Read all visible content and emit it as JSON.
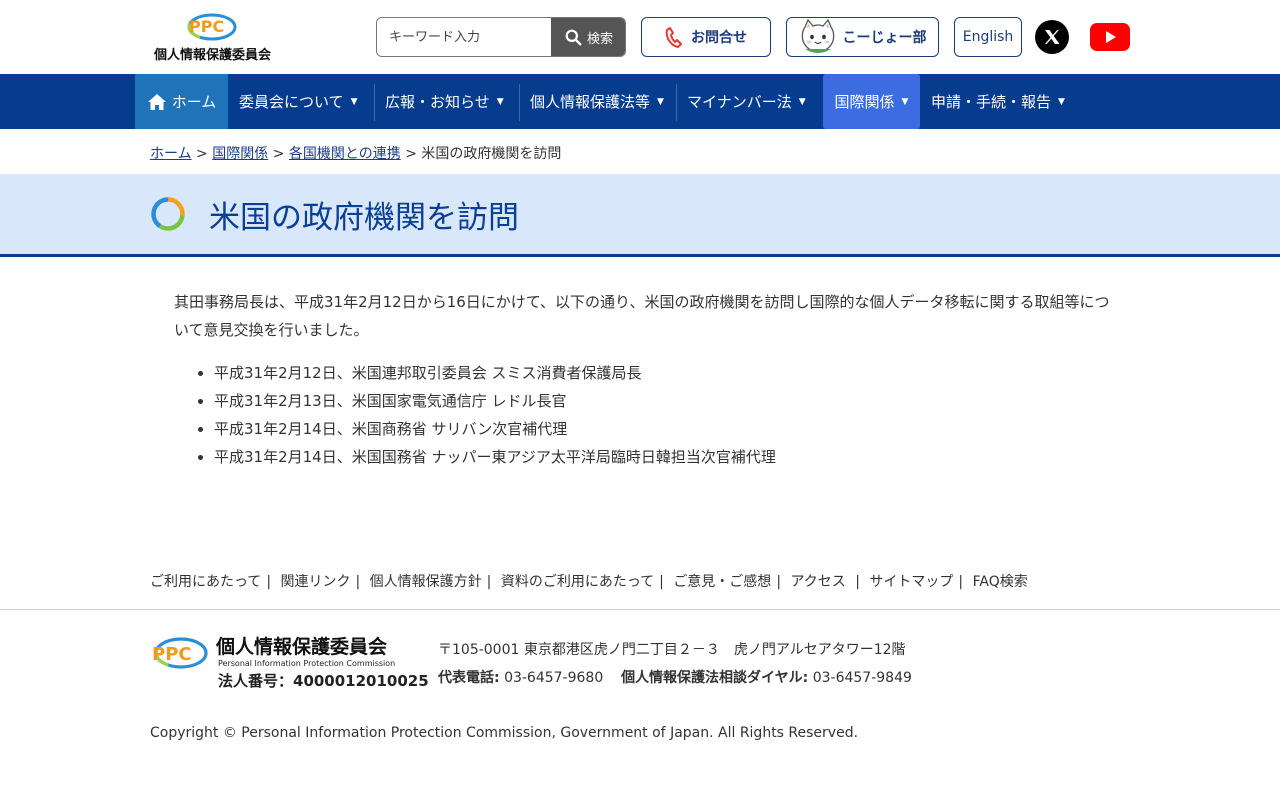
{
  "header": {
    "logo_text": "個人情報保護委員会",
    "logo_mark": "PPC",
    "search": {
      "placeholder": "キーワード入力",
      "button_label": "検索"
    },
    "contact_label": "お問合せ",
    "koujo_label": "こーじょー部",
    "english_label": "English",
    "icons": [
      "search-icon",
      "phone-icon",
      "cat-mascot-icon",
      "x-icon",
      "youtube-icon"
    ]
  },
  "nav": {
    "home": "ホーム",
    "items": [
      "委員会について",
      "広報・お知らせ",
      "個人情報保護法等",
      "マイナンバー法",
      "国際関係",
      "申請・手続・報告"
    ],
    "caret": "▼",
    "active": "国際関係"
  },
  "breadcrumb": {
    "items": [
      "ホーム",
      "国際関係",
      "各国機関との連携"
    ],
    "current": "米国の政府機関を訪問",
    "separator": ">"
  },
  "page": {
    "title": "米国の政府機関を訪問",
    "intro": "其田事務局長は、平成31年2月12日から16日にかけて、以下の通り、米国の政府機関を訪問し国際的な個人データ移転に関する取組等について意見交換を行いました。",
    "visits": [
      "平成31年2月12日、米国連邦取引委員会 スミス消費者保護局長",
      "平成31年2月13日、米国国家電気通信庁 レドル長官",
      "平成31年2月14日、米国商務省 サリバン次官補代理",
      "平成31年2月14日、米国国務省 ナッパー東アジア太平洋局臨時日韓担当次官補代理"
    ]
  },
  "footer": {
    "links": [
      "ご利用にあたって",
      "関連リンク",
      "個人情報保護方針",
      "資料のご利用にあたって",
      "ご意見・ご感想",
      "アクセス",
      "サイトマップ",
      "FAQ検索"
    ],
    "org_name": "個人情報保護委員会",
    "org_name_en": "Personal Information Protection Commission",
    "corp_number": "法人番号：4000012010025",
    "address": "〒105-0001 東京都港区虎ノ門二丁目２－３　虎ノ門アルセアタワー12階",
    "main_phone_label": "代表電話:",
    "main_phone": "03-6457-9680",
    "consult_label": "個人情報保護法相談ダイヤル:",
    "consult_phone": "03-6457-9849",
    "copyright": "Copyright © Personal Information Protection Commission, Government of Japan. All Rights Reserved."
  },
  "colors": {
    "nav_bg": "#063c8e",
    "nav_home_bg": "#1e73b9",
    "nav_active_bg": "#3b6de0",
    "title_band_bg": "#d9e7fb",
    "title_text": "#0a3f93",
    "link": "#1a3d8a"
  }
}
